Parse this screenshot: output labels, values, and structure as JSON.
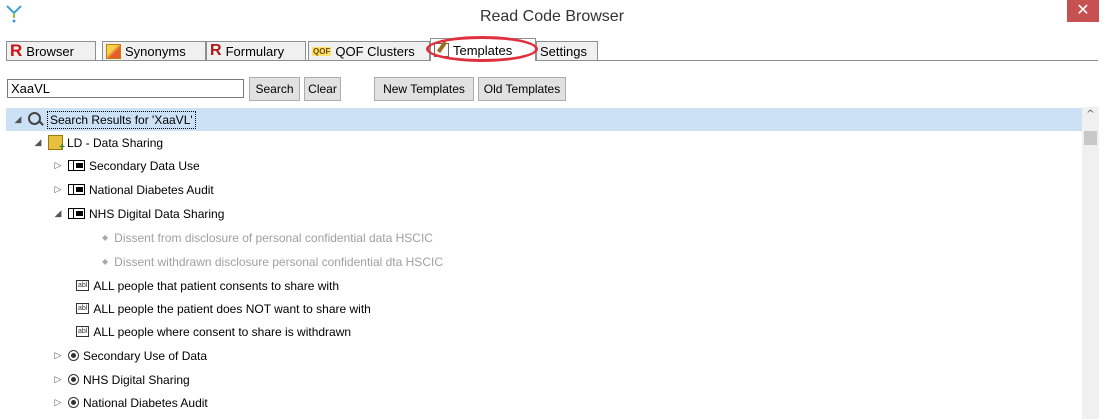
{
  "window": {
    "title": "Read Code Browser",
    "close_glyph": "✕"
  },
  "tabs": [
    {
      "label": "Browser",
      "icon": "r-icon"
    },
    {
      "label": "Synonyms",
      "icon": "synonyms-icon"
    },
    {
      "label": "Formulary",
      "icon": "formulary-icon"
    },
    {
      "label": "QOF Clusters",
      "icon": "qof-icon",
      "icon_text": "QOF"
    },
    {
      "label": "Templates",
      "icon": "templates-icon",
      "active": true
    },
    {
      "label": "Settings"
    }
  ],
  "search": {
    "value": "XaaVL",
    "search_label": "Search",
    "clear_label": "Clear",
    "new_templates_label": "New Templates",
    "old_templates_label": "Old Templates"
  },
  "tree": {
    "root": "Search Results for 'XaaVL'",
    "group": "LD - Data Sharing",
    "items": [
      "Secondary Data Use",
      "National Diabetes Audit",
      "NHS Digital Data Sharing",
      "Dissent from disclosure of personal confidential data HSCIC",
      "Dissent withdrawn disclosure personal confidential dta HSCIC",
      "ALL people that patient consents to share with",
      "ALL people the patient does NOT want to share with",
      "ALL people where consent to share is withdrawn",
      "Secondary Use of Data",
      "NHS Digital Sharing",
      "National Diabetes Audit"
    ]
  },
  "colors": {
    "selection": "#cce1f5",
    "highlight_ring": "#e0303e",
    "close": "#c75050"
  }
}
